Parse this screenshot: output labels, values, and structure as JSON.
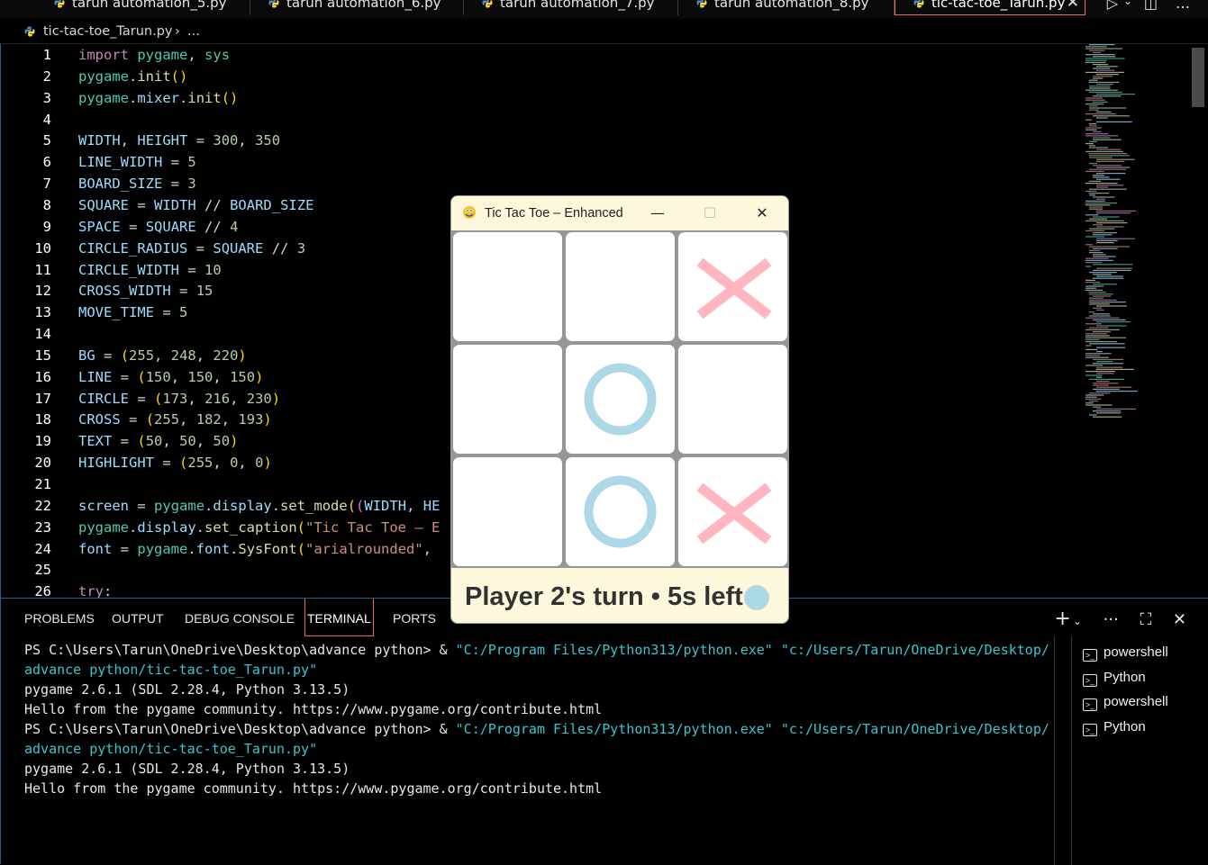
{
  "tabs": [
    {
      "label": "tarun automation_5.py"
    },
    {
      "label": "tarun automation_6.py"
    },
    {
      "label": "tarun automation_7.py"
    },
    {
      "label": "tarun automation_8.py"
    },
    {
      "label": "tic-tac-toe_Tarun.py",
      "active": true,
      "close": "✕"
    }
  ],
  "tabbar_actions": {
    "run": "▷",
    "chevron": "⌄",
    "split": "◫",
    "more": "…"
  },
  "breadcrumb": {
    "file": "tic-tac-toe_Tarun.py",
    "separator": "›",
    "more": "..."
  },
  "editor": {
    "line_numbers": [
      "1",
      "2",
      "3",
      "4",
      "5",
      "6",
      "7",
      "8",
      "9",
      "10",
      "11",
      "12",
      "13",
      "14",
      "15",
      "16",
      "17",
      "18",
      "19",
      "20",
      "21",
      "22",
      "23",
      "24",
      "25",
      "26"
    ],
    "lines": [
      "import pygame, sys",
      "pygame.init()",
      "pygame.mixer.init()",
      "",
      "WIDTH, HEIGHT = 300, 350",
      "LINE_WIDTH = 5",
      "BOARD_SIZE = 3",
      "SQUARE = WIDTH // BOARD_SIZE",
      "SPACE = SQUARE // 4",
      "CIRCLE_RADIUS = SQUARE // 3",
      "CIRCLE_WIDTH = 10",
      "CROSS_WIDTH = 15",
      "MOVE_TIME = 5",
      "",
      "BG = (255, 248, 220)",
      "LINE = (150, 150, 150)",
      "CIRCLE = (173, 216, 230)",
      "CROSS = (255, 182, 193)",
      "TEXT = (50, 50, 50)",
      "HIGHLIGHT = (255, 0, 0)",
      "",
      "screen = pygame.display.set_mode((WIDTH, HE",
      "pygame.display.set_caption(\"Tic Tac Toe – E",
      "font = pygame.font.SysFont(\"arialrounded\",",
      "",
      "try:"
    ]
  },
  "panel": {
    "tabs": [
      "PROBLEMS",
      "OUTPUT",
      "DEBUG CONSOLE",
      "TERMINAL",
      "PORTS"
    ],
    "active_tab": "TERMINAL",
    "actions": {
      "add": "+",
      "chevron": "⌄",
      "more": "···",
      "maximize": "⛶",
      "close": "✕"
    }
  },
  "terminal": {
    "lines": [
      {
        "pre": "PS C:\\Users\\Tarun\\OneDrive\\Desktop\\advance python> & ",
        "str": "\"C:/Program Files/Python313/python.exe\" \"c:/Users/Tarun/OneDrive/Desktop/"
      },
      {
        "pre": "",
        "str": "advance python/tic-tac-toe_Tarun.py\""
      },
      {
        "pre": "pygame 2.6.1 (SDL 2.28.4, Python 3.13.5)",
        "str": ""
      },
      {
        "pre": "Hello from the pygame community. https://www.pygame.org/contribute.html",
        "str": ""
      },
      {
        "pre": "PS C:\\Users\\Tarun\\OneDrive\\Desktop\\advance python> & ",
        "str": "\"C:/Program Files/Python313/python.exe\" \"c:/Users/Tarun/OneDrive/Desktop/"
      },
      {
        "pre": "",
        "str": "advance python/tic-tac-toe_Tarun.py\""
      },
      {
        "pre": "pygame 2.6.1 (SDL 2.28.4, Python 3.13.5)",
        "str": ""
      },
      {
        "pre": "Hello from the pygame community. https://www.pygame.org/contribute.html",
        "str": ""
      }
    ],
    "sessions": [
      "powershell",
      "Python",
      "powershell",
      "Python"
    ]
  },
  "game_window": {
    "title": "Tic Tac Toe – Enhanced",
    "controls": {
      "minimize": "—",
      "maximize": "☐",
      "close": "✕"
    },
    "board": [
      "",
      "",
      "X",
      "",
      "O",
      "",
      "",
      "O",
      "X"
    ],
    "status": "Player 2's turn • 5s left",
    "colors": {
      "bg": "#fff8dc",
      "line": "#969696",
      "circle": "#add8e6",
      "cross": "#ffb6c1",
      "text": "#323232"
    }
  }
}
